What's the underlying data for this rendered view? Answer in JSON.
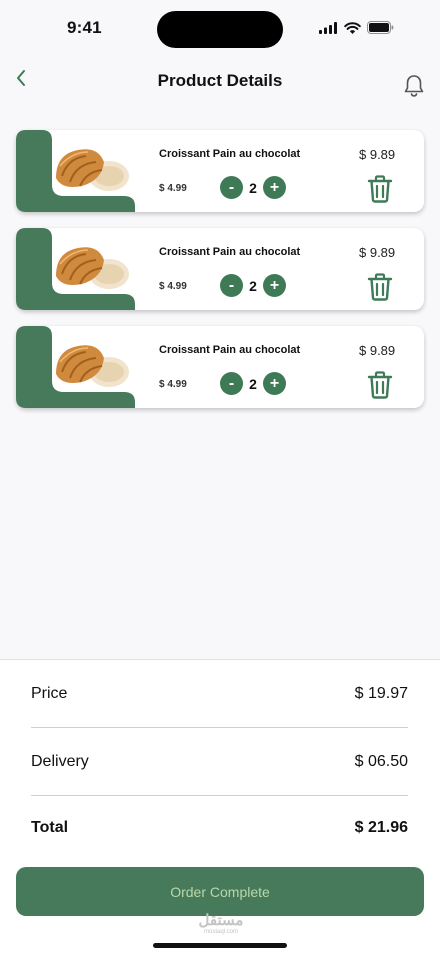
{
  "status_bar": {
    "time": "9:41"
  },
  "header": {
    "title": "Product Details"
  },
  "icons": {
    "back": "chevron-left-icon",
    "bell": "bell-icon",
    "trash": "trash-icon"
  },
  "colors": {
    "accent": "#477a5b",
    "button_text": "#b9d8a9"
  },
  "cart": {
    "items": [
      {
        "name": "Croissant Pain au chocolat",
        "unit_price": "$ 4.99",
        "quantity": "2",
        "line_total": "$ 9.89",
        "minus": "-",
        "plus": "+"
      },
      {
        "name": "Croissant Pain au chocolat",
        "unit_price": "$ 4.99",
        "quantity": "2",
        "line_total": "$ 9.89",
        "minus": "-",
        "plus": "+"
      },
      {
        "name": "Croissant Pain au chocolat",
        "unit_price": "$ 4.99",
        "quantity": "2",
        "line_total": "$ 9.89",
        "minus": "-",
        "plus": "+"
      }
    ]
  },
  "summary": {
    "price_label": "Price",
    "price_value": "$ 19.97",
    "delivery_label": "Delivery",
    "delivery_value": "$ 06.50",
    "total_label": "Total",
    "total_value": "$ 21.96",
    "order_button": "Order Complete"
  },
  "watermark": {
    "main": "مستقل",
    "sub": "mostaql.com"
  }
}
